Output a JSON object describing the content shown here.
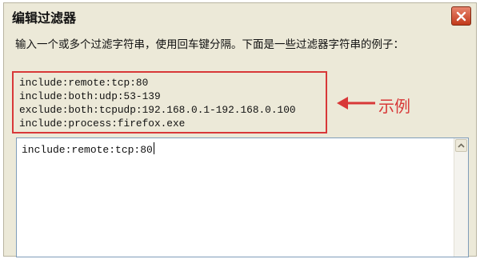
{
  "dialog": {
    "title": "编辑过滤器",
    "close_icon": "close-icon"
  },
  "description": "输入一个或多个过滤字符串，使用回车键分隔。下面是一些过滤器字符串的例子：",
  "examples": [
    "include:remote:tcp:80",
    "include:both:udp:53-139",
    "exclude:both:tcpudp:192.168.0.1-192.168.0.100",
    "include:process:firefox.exe"
  ],
  "annotation": {
    "label": "示例",
    "color": "#d83838",
    "icon": "arrow-left-icon"
  },
  "filter_input": {
    "value": "include:remote:tcp:80"
  },
  "scrollbar": {
    "up_icon": "chevron-up-icon"
  }
}
